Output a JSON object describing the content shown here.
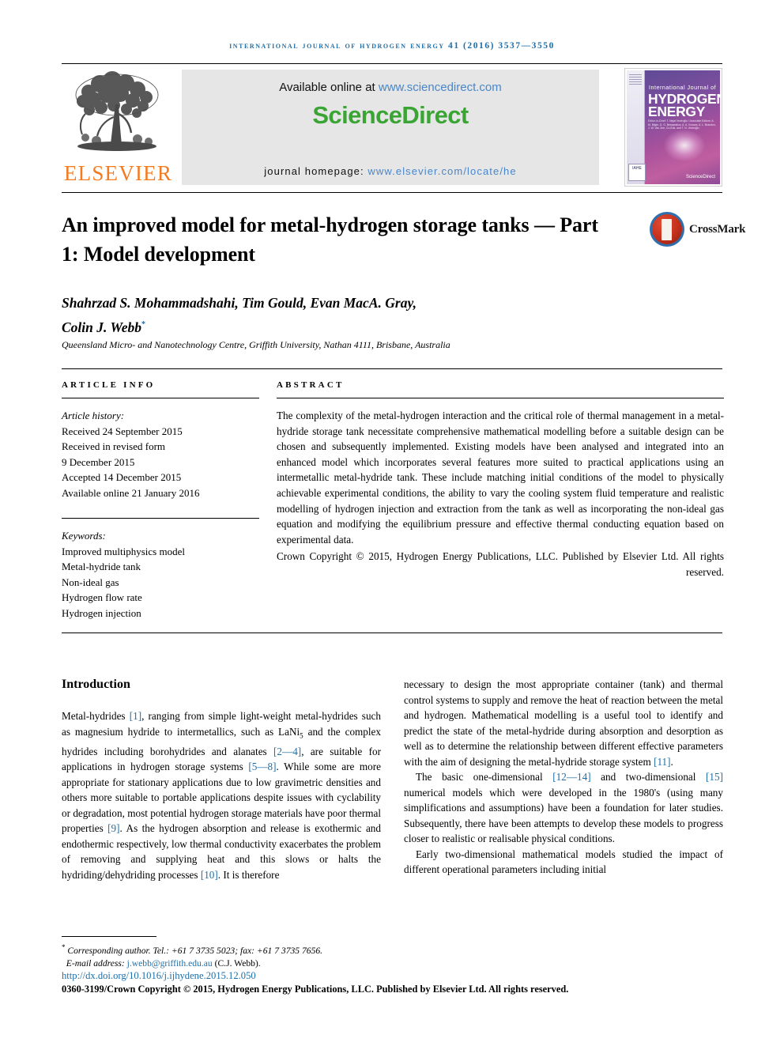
{
  "running_head": "International Journal of Hydrogen Energy 41 (2016) 3537—3550",
  "masthead": {
    "elsevier_wordmark": "ELSEVIER",
    "available_prefix": "Available online at ",
    "available_url": "www.sciencedirect.com",
    "sciencedirect_logo": "ScienceDirect",
    "homepage_prefix": "journal homepage: ",
    "homepage_url": "www.elsevier.com/locate/he",
    "cover": {
      "line1": "International Journal of",
      "line2": "HYDROGEN",
      "line3": "ENERGY",
      "editors": "Editor-in-Chief: T. Nejat Veziroğlu / Associate Editors: A. M. Bilgin, D. G. Bessarabov, A. A. Kovacs, A. L. Brandon, J. W. Van Zee, Co-Eds. and T. N. Veziroğlu",
      "badge": "IAHE",
      "sciencedirect": "ScienceDirect"
    }
  },
  "article": {
    "title": "An improved model for metal-hydrogen storage tanks — Part 1: Model development",
    "crossmark_label": "CrossMark",
    "authors": "Shahrzad S. Mohammadshahi, Tim Gould, Evan MacA. Gray, Colin J. Webb",
    "authors_line1": "Shahrzad S. Mohammadshahi, Tim Gould, Evan MacA. Gray,",
    "authors_line2": "Colin J. Webb",
    "corresponding_marker": "*",
    "affiliation": "Queensland Micro- and Nanotechnology Centre, Griffith University, Nathan 4111, Brisbane, Australia"
  },
  "article_info": {
    "heading": "ARTICLE INFO",
    "history_label": "Article history:",
    "history": [
      "Received 24 September 2015",
      "Received in revised form",
      "9 December 2015",
      "Accepted 14 December 2015",
      "Available online 21 January 2016"
    ],
    "keywords_label": "Keywords:",
    "keywords": [
      "Improved multiphysics model",
      "Metal-hydride tank",
      "Non-ideal gas",
      "Hydrogen flow rate",
      "Hydrogen injection"
    ]
  },
  "abstract": {
    "heading": "ABSTRACT",
    "text": "The complexity of the metal-hydrogen interaction and the critical role of thermal management in a metal-hydride storage tank necessitate comprehensive mathematical modelling before a suitable design can be chosen and subsequently implemented. Existing models have been analysed and integrated into an enhanced model which incorporates several features more suited to practical applications using an intermetallic metal-hydride tank. These include matching initial conditions of the model to physically achievable experimental conditions, the ability to vary the cooling system fluid temperature and realistic modelling of hydrogen injection and extraction from the tank as well as incorporating the non-ideal gas equation and modifying the equilibrium pressure and effective thermal conducting equation based on experimental data.",
    "copyright": "Crown Copyright © 2015, Hydrogen Energy Publications, LLC. Published by Elsevier Ltd. All rights reserved."
  },
  "introduction": {
    "heading": "Introduction",
    "left_paragraph_parts": {
      "p1_a": "Metal-hydrides ",
      "p1_r1": "[1]",
      "p1_b": ", ranging from simple light-weight metal-hydrides such as magnesium hydride to intermetallics, such as LaNi",
      "p1_sub": "5",
      "p1_c": " and the complex hydrides including borohydrides and alanates ",
      "p1_r2": "[2—4]",
      "p1_d": ", are suitable for applications in hydrogen storage systems ",
      "p1_r3": "[5—8]",
      "p1_e": ". While some are more appropriate for stationary applications due to low gravimetric densities and others more suitable to portable applications despite issues with cyclability or degradation, most potential hydrogen storage materials have poor thermal properties ",
      "p1_r4": "[9]",
      "p1_f": ". As the hydrogen absorption and release is exothermic and endothermic respectively, low thermal conductivity exacerbates the problem of removing and supplying heat and this slows or halts the hydriding/dehydriding processes ",
      "p1_r5": "[10]",
      "p1_g": ". It is therefore"
    },
    "right_paragraph_parts": {
      "p1_a": "necessary to design the most appropriate container (tank) and thermal control systems to supply and remove the heat of reaction between the metal and hydrogen. Mathematical modelling is a useful tool to identify and predict the state of the metal-hydride during absorption and desorption as well as to determine the relationship between different effective parameters with the aim of designing the metal-hydride storage system ",
      "p1_r1": "[11]",
      "p1_b": ".",
      "p2_a": "The basic one-dimensional ",
      "p2_r1": "[12—14]",
      "p2_b": " and two-dimensional ",
      "p2_r2": "[15]",
      "p2_c": " numerical models which were developed in the 1980's (using many simplifications and assumptions) have been a foundation for later studies. Subsequently, there have been attempts to develop these models to progress closer to realistic or realisable physical conditions.",
      "p3_a": "Early two-dimensional mathematical models studied the impact of different operational parameters including initial"
    }
  },
  "footer": {
    "corresponding_star": "*",
    "corresponding_text": "Corresponding author. Tel.: +61 7 3735 5023; fax: +61 7 3735 7656.",
    "email_label": "E-mail address: ",
    "email": "j.webb@griffith.edu.au",
    "email_owner": " (C.J. Webb).",
    "doi": "http://dx.doi.org/10.1016/j.ijhydene.2015.12.050",
    "issn_line": "0360-3199/Crown Copyright © 2015, Hydrogen Energy Publications, LLC. Published by Elsevier Ltd. All rights reserved."
  },
  "colors": {
    "link": "#1e6fa8",
    "elsevier_orange": "#f47b20",
    "sciencedirect_green": "#3aa534",
    "banner_bg": "#e6e6e6"
  }
}
